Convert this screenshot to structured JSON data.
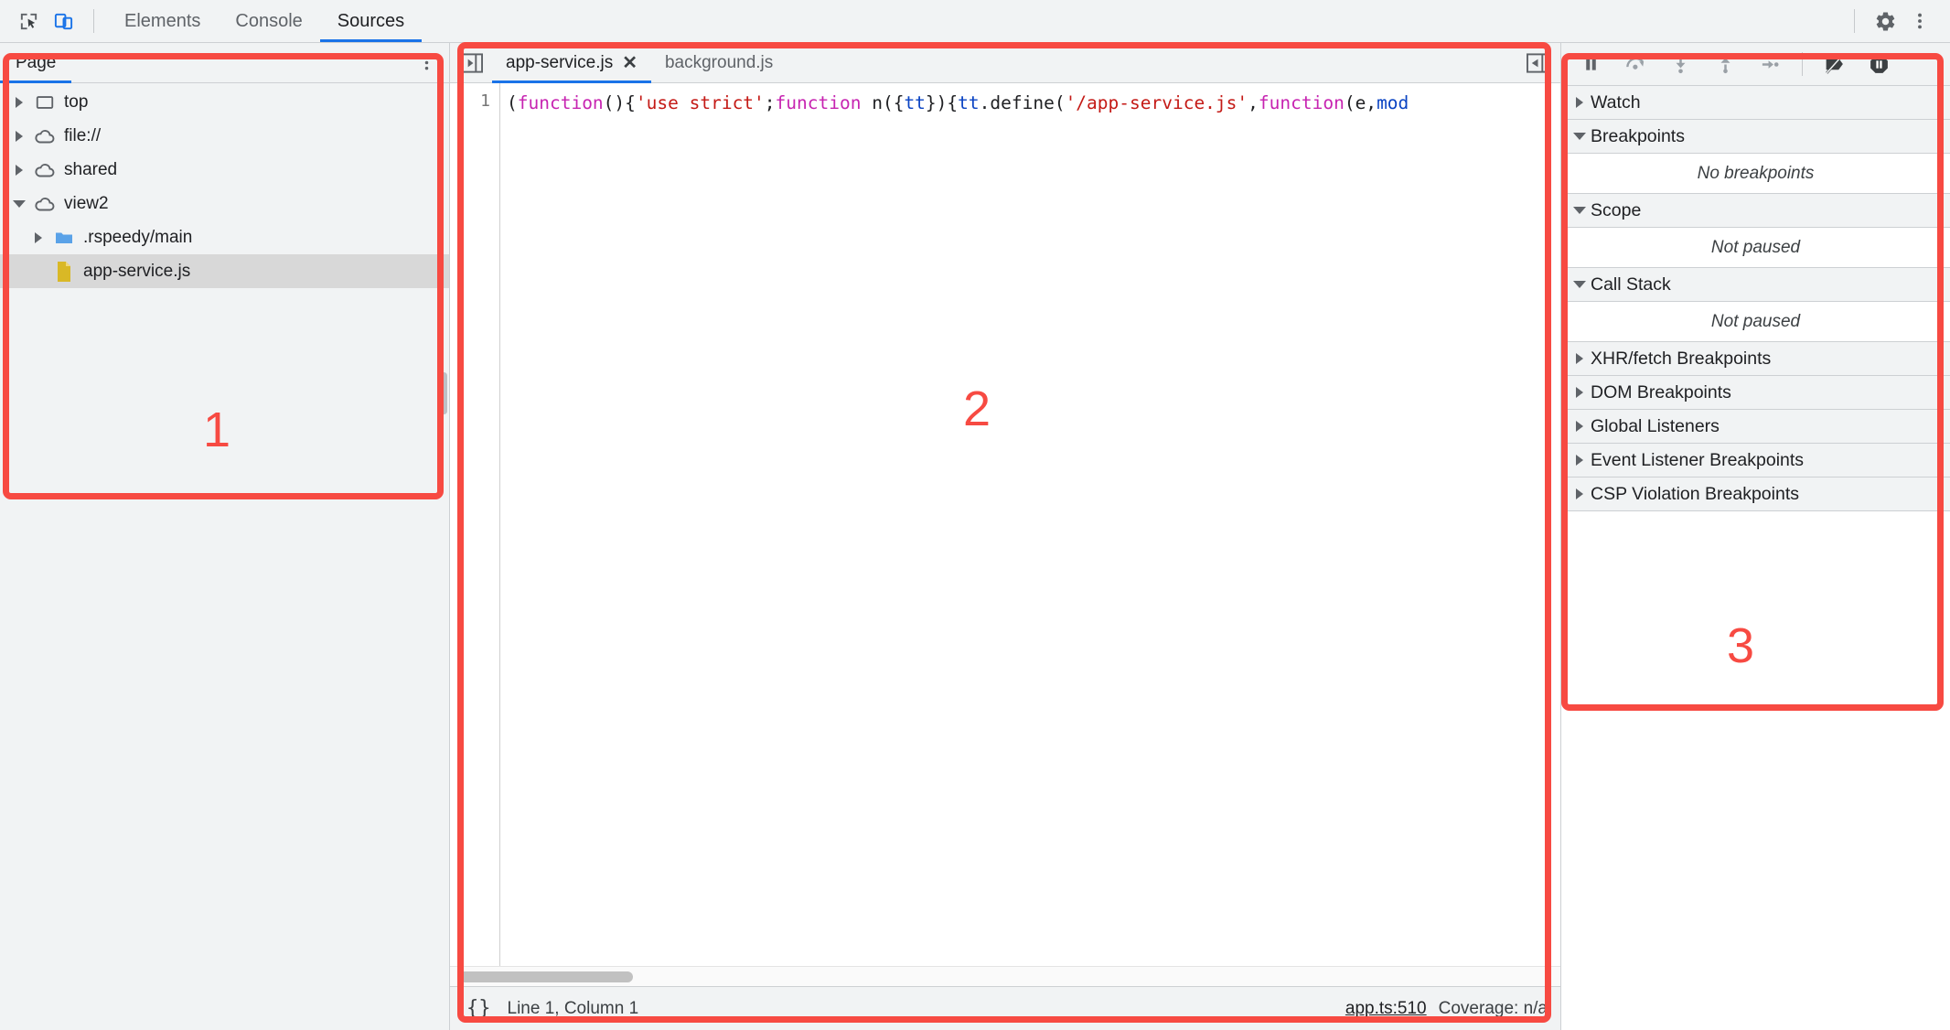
{
  "topbar": {
    "icons": [
      {
        "name": "inspect-element-icon",
        "title": "Inspect element"
      },
      {
        "name": "device-toolbar-icon",
        "title": "Toggle device toolbar"
      }
    ],
    "tabs": [
      {
        "label": "Elements",
        "active": false
      },
      {
        "label": "Console",
        "active": false
      },
      {
        "label": "Sources",
        "active": true
      }
    ],
    "right_icons": [
      {
        "name": "gear-icon",
        "title": "Settings"
      },
      {
        "name": "more-vertical-icon",
        "title": "Customize and control DevTools"
      }
    ]
  },
  "navigator": {
    "tab_label": "Page",
    "menu_icon": "more-vertical-icon",
    "tree": [
      {
        "label": "top",
        "icon": "frame-icon",
        "depth": 0,
        "arrow": "collapsed",
        "selected": false
      },
      {
        "label": "file://",
        "icon": "cloud-icon",
        "depth": 0,
        "arrow": "collapsed",
        "selected": false
      },
      {
        "label": "shared",
        "icon": "cloud-icon",
        "depth": 0,
        "arrow": "collapsed",
        "selected": false
      },
      {
        "label": "view2",
        "icon": "cloud-icon",
        "depth": 0,
        "arrow": "expanded",
        "selected": false
      },
      {
        "label": ".rspeedy/main",
        "icon": "folder-icon",
        "depth": 1,
        "arrow": "collapsed",
        "selected": false
      },
      {
        "label": "app-service.js",
        "icon": "file-js-icon",
        "depth": 2,
        "arrow": "none",
        "selected": true
      }
    ]
  },
  "editor": {
    "nav_button_icon": "show-navigator-icon",
    "expand_button_icon": "show-debugger-icon",
    "tabs": [
      {
        "label": "app-service.js",
        "active": true,
        "closable": true,
        "close_icon": "close-icon"
      },
      {
        "label": "background.js",
        "active": false,
        "closable": false,
        "close_icon": ""
      }
    ],
    "line_numbers": [
      "1"
    ],
    "code_tokens": [
      {
        "text": "(",
        "type": "plain"
      },
      {
        "text": "function",
        "type": "keyword"
      },
      {
        "text": "(){",
        "type": "plain"
      },
      {
        "text": "'use strict'",
        "type": "string"
      },
      {
        "text": ";",
        "type": "plain"
      },
      {
        "text": "function",
        "type": "keyword"
      },
      {
        "text": " n({",
        "type": "plain"
      },
      {
        "text": "tt",
        "type": "variable"
      },
      {
        "text": "}){",
        "type": "plain"
      },
      {
        "text": "tt",
        "type": "variable"
      },
      {
        "text": ".define(",
        "type": "plain"
      },
      {
        "text": "'/app-service.js'",
        "type": "string"
      },
      {
        "text": ",",
        "type": "plain"
      },
      {
        "text": "function",
        "type": "keyword"
      },
      {
        "text": "(e,",
        "type": "plain"
      },
      {
        "text": "mod",
        "type": "variable"
      }
    ],
    "status": {
      "format_button": "{}",
      "cursor_position": "Line 1, Column 1",
      "source_map_link": "app.ts:510",
      "coverage": "Coverage: n/a"
    }
  },
  "debugger": {
    "toolbar": [
      {
        "name": "pause-script-icon",
        "title": "Pause script execution"
      },
      {
        "name": "step-over-icon",
        "title": "Step over next function call"
      },
      {
        "name": "step-into-icon",
        "title": "Step into next function call"
      },
      {
        "name": "step-out-icon",
        "title": "Step out of current function"
      },
      {
        "name": "step-icon",
        "title": "Step"
      },
      {
        "name": "deactivate-breakpoints-icon",
        "title": "Deactivate breakpoints"
      },
      {
        "name": "pause-on-exceptions-icon",
        "title": "Pause on exceptions"
      }
    ],
    "sections": [
      {
        "title": "Watch",
        "expanded": false,
        "body": null
      },
      {
        "title": "Breakpoints",
        "expanded": true,
        "body": "No breakpoints"
      },
      {
        "title": "Scope",
        "expanded": true,
        "body": "Not paused"
      },
      {
        "title": "Call Stack",
        "expanded": true,
        "body": "Not paused"
      },
      {
        "title": "XHR/fetch Breakpoints",
        "expanded": false,
        "body": null
      },
      {
        "title": "DOM Breakpoints",
        "expanded": false,
        "body": null
      },
      {
        "title": "Global Listeners",
        "expanded": false,
        "body": null
      },
      {
        "title": "Event Listener Breakpoints",
        "expanded": false,
        "body": null
      },
      {
        "title": "CSP Violation Breakpoints",
        "expanded": false,
        "body": null
      }
    ]
  },
  "annotations": {
    "color": "#f74a42",
    "labels": [
      "1",
      "2",
      "3"
    ]
  }
}
